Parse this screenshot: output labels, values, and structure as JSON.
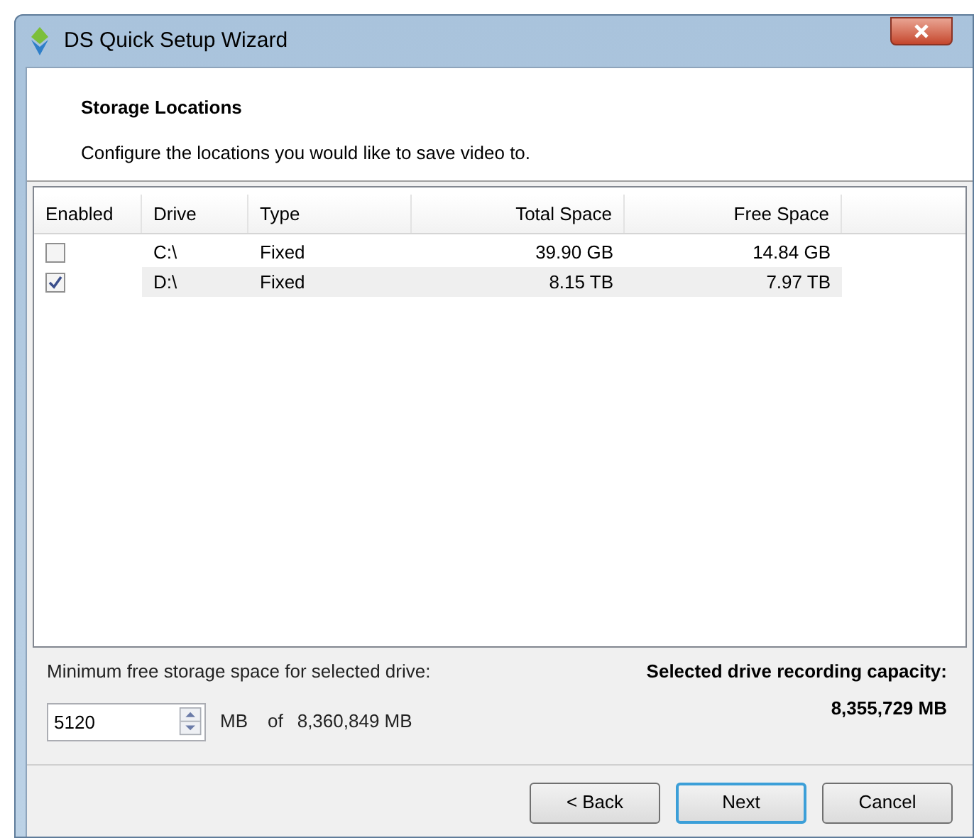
{
  "window": {
    "title": "DS Quick Setup Wizard"
  },
  "header": {
    "title": "Storage Locations",
    "description": "Configure the locations you would like to save video to."
  },
  "table": {
    "columns": [
      "Enabled",
      "Drive",
      "Type",
      "Total Space",
      "Free Space"
    ],
    "rows": [
      {
        "enabled": false,
        "selected": false,
        "drive": "C:\\",
        "type": "Fixed",
        "total": "39.90 GB",
        "free": "14.84 GB"
      },
      {
        "enabled": true,
        "selected": true,
        "drive": "D:\\",
        "type": "Fixed",
        "total": "8.15 TB",
        "free": "7.97 TB"
      }
    ]
  },
  "min_space": {
    "label": "Minimum free storage space for selected drive:",
    "value": "5120",
    "unit": "MB",
    "of": "of",
    "max": "8,360,849 MB"
  },
  "capacity": {
    "label": "Selected drive recording capacity:",
    "value": "8,355,729 MB"
  },
  "buttons": [
    {
      "label": "< Back",
      "default": false
    },
    {
      "label": "Next",
      "default": true
    },
    {
      "label": "Cancel",
      "default": false
    }
  ]
}
